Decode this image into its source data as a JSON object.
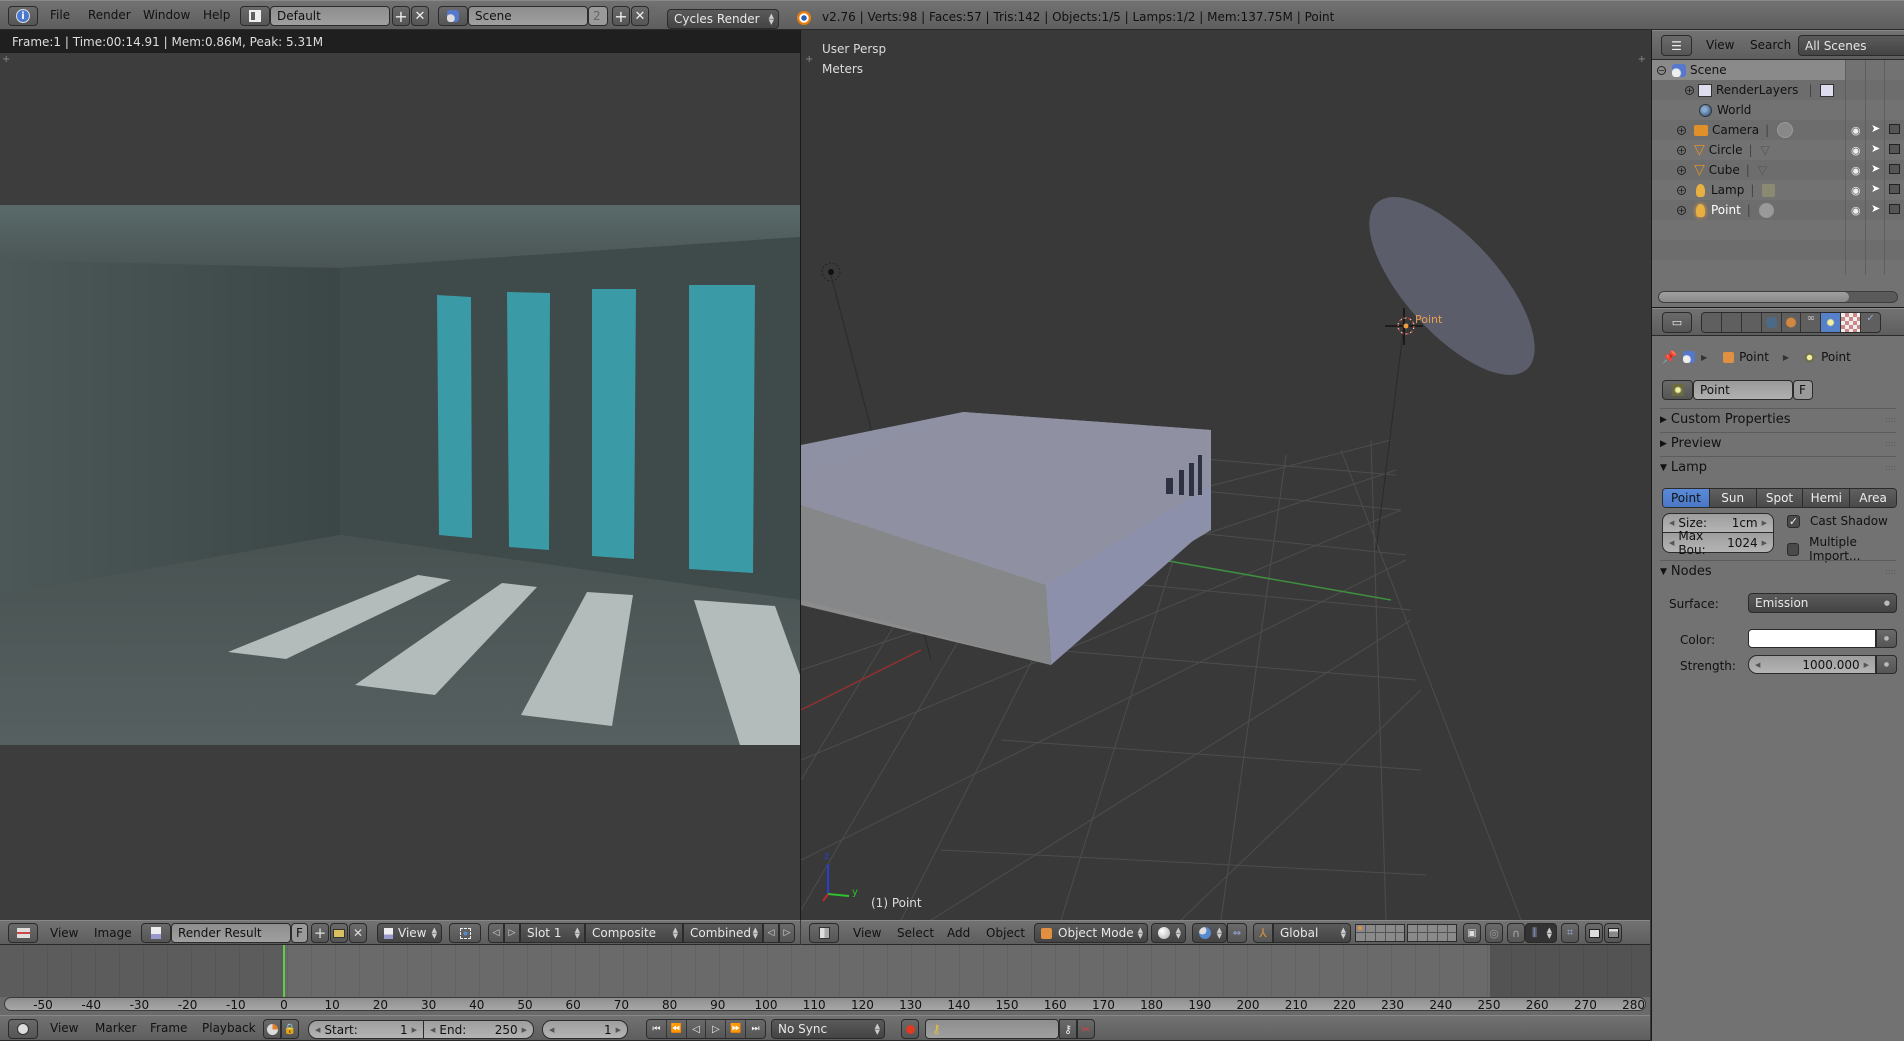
{
  "top_bar": {
    "info_icon": "info-icon",
    "menus": [
      "File",
      "Render",
      "Window",
      "Help"
    ],
    "screen_layout": "Default",
    "scene": "Scene",
    "scene_users": "2",
    "render_engine": "Cycles Render",
    "stats": "v2.76 | Verts:98 | Faces:57 | Tris:142 | Objects:1/5 | Lamps:1/2 | Mem:137.75M | Point"
  },
  "image_editor": {
    "render_info": "Frame:1 | Time:00:14.91 | Mem:0.86M, Peak: 5.31M",
    "header": {
      "menus": [
        "View",
        "Image"
      ],
      "image_name": "Render Result",
      "fake_user": "F",
      "view_label": "View",
      "slot": "Slot 1",
      "layer": "Composite",
      "pass": "Combined"
    },
    "colors": {
      "window_light": "#3a9aa6",
      "floor_light": "#b8c0c0",
      "wall": "#3f4a4a"
    }
  },
  "viewport": {
    "view_name": "User Persp",
    "units": "Meters",
    "selected_object_label": "(1) Point",
    "lamp_label": "Point",
    "axis_labels": {
      "y": "y",
      "z": "z"
    },
    "header": {
      "menus": [
        "View",
        "Select",
        "Add",
        "Object"
      ],
      "mode": "Object Mode",
      "orientation": "Global"
    }
  },
  "outliner": {
    "header": {
      "menus": [
        "View",
        "Search"
      ],
      "display_mode": "All Scenes"
    },
    "items": [
      {
        "name": "Scene",
        "icon": "scene-icon",
        "level": 0
      },
      {
        "name": "RenderLayers",
        "icon": "render-layers-icon",
        "level": 1
      },
      {
        "name": "World",
        "icon": "world-icon",
        "level": 1
      },
      {
        "name": "Camera",
        "icon": "camera-icon",
        "level": 1
      },
      {
        "name": "Circle",
        "icon": "mesh-icon",
        "level": 1
      },
      {
        "name": "Cube",
        "icon": "mesh-icon",
        "level": 1
      },
      {
        "name": "Lamp",
        "icon": "lamp-icon",
        "level": 1
      },
      {
        "name": "Point",
        "icon": "lamp-icon",
        "level": 1,
        "selected": true
      }
    ],
    "scroll_fraction": 0.8
  },
  "properties": {
    "breadcrumb": [
      "Point",
      "Point"
    ],
    "datablock_name": "Point",
    "fake_user": "F",
    "panels": {
      "custom_properties": "Custom Properties",
      "preview": "Preview",
      "lamp": "Lamp",
      "nodes": "Nodes"
    },
    "lamp_types": [
      "Point",
      "Sun",
      "Spot",
      "Hemi",
      "Area"
    ],
    "active_lamp_type": "Point",
    "size_label": "Size:",
    "size_value": "1cm",
    "max_bounces_label": "Max Bou:",
    "max_bounces_value": "1024",
    "cast_shadow_label": "Cast Shadow",
    "cast_shadow": true,
    "multiple_importance_label": "Multiple Import...",
    "multiple_importance": false,
    "surface_label": "Surface:",
    "surface_value": "Emission",
    "color_label": "Color:",
    "color_value": "#ffffff",
    "strength_label": "Strength:",
    "strength_value": "1000.000"
  },
  "timeline": {
    "ruler": [
      "-50",
      "-40",
      "-30",
      "-20",
      "-10",
      "0",
      "10",
      "20",
      "30",
      "40",
      "50",
      "60",
      "70",
      "80",
      "90",
      "100",
      "110",
      "120",
      "130",
      "140",
      "150",
      "160",
      "170",
      "180",
      "190",
      "200",
      "210",
      "220",
      "230",
      "240",
      "250",
      "260",
      "270",
      "280"
    ],
    "current_frame_marker": 0,
    "header": {
      "menus": [
        "View",
        "Marker",
        "Frame",
        "Playback"
      ],
      "start_label": "Start:",
      "start_value": "1",
      "end_label": "End:",
      "end_value": "250",
      "current_frame": "1",
      "sync": "No Sync"
    }
  }
}
